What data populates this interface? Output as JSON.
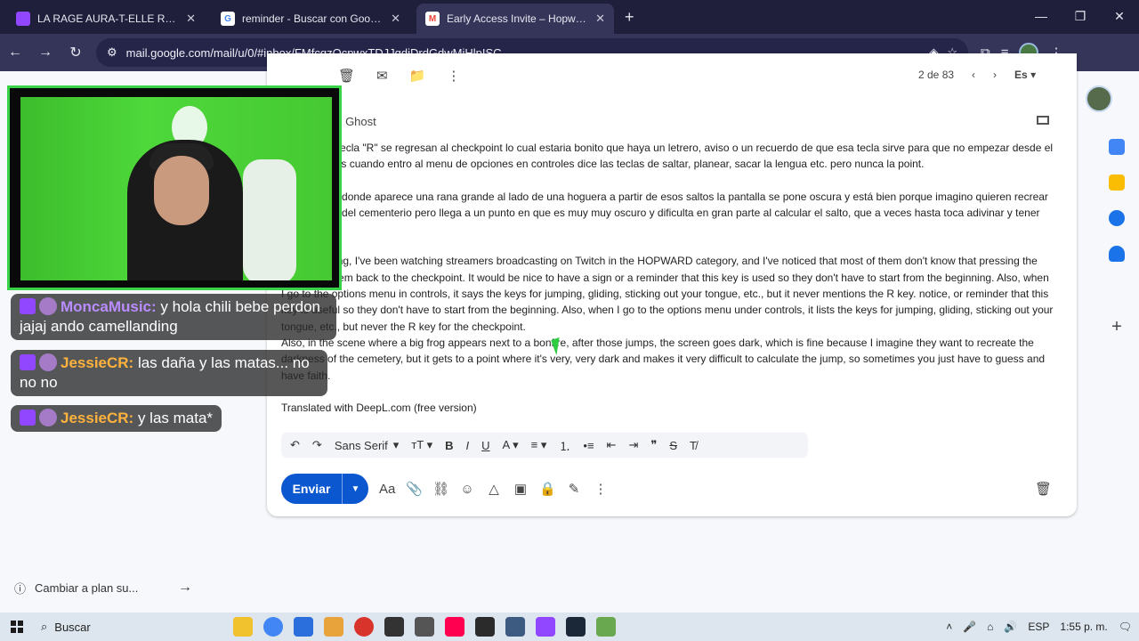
{
  "tabs": [
    {
      "title": "LA RAGE AURA-T-ELLE RAIS",
      "favicon_color": "#9146ff",
      "active": false
    },
    {
      "title": "reminder - Buscar con Google",
      "favicon_color": "#ffffff",
      "active": false
    },
    {
      "title": "Early Access Invite – Hopward L",
      "favicon_color": "#ea4335",
      "active": true
    }
  ],
  "address": {
    "url": "mail.google.com/mail/u/0/#inbox/FMfcgzQcpwxTDJJqdjDrdGdwMjHlpISC"
  },
  "gmail": {
    "pager": "2 de 83",
    "lang": "Es",
    "subject": "od Ghost",
    "body": [
      "en que con tecla \"R\" se regresan al checkpoint lo cual estaria bonito que haya un letrero, aviso o un recuerdo de que esa tecla sirve para que no empezar desde el inicio ademas cuando entro al menu de opciones en controles dice las teclas de saltar, planear, sacar la lengua etc. pero nunca la point.",
      "el escenario donde aparece una rana grande al lado de una hoguera a partir de esos saltos la pantalla se pone oscura y está bien porque imagino quieren recrear la oscuridad del cementerio pero llega a un punto en que es muy muy oscuro y dificulta en gran parte al calcular el salto, que a veces hasta toca adivinar y tener fe.",
      "Good morning, I've been watching streamers broadcasting on Twitch in the HOPWARD category, and I've noticed that most of them don't know that pressing the key takes them back to the checkpoint. It would be nice to have a sign or a reminder that this key is used so they don't have to start from the beginning. Also, when I go to the options menu in controls, it says the keys for jumping, gliding, sticking out your tongue, etc., but it never mentions the R key. notice, or reminder that this key is useful so they don't have to start from the beginning. Also, when I go to the options menu under controls, it lists the keys for jumping, gliding, sticking out your tongue, etc., but never the R key for the checkpoint.",
      "Also, in the scene where a big frog appears next to a bonfire, after those jumps, the screen goes dark, which is fine because I imagine they want to recreate the darkness of the cemetery, but it gets to a point where it's very, very dark and makes it very difficult to calculate the jump, so sometimes you just have to guess and have faith.",
      "Translated with DeepL.com (free version)"
    ],
    "font_select": "Sans Serif",
    "send_label": "Enviar",
    "sidebar_footer": "Cambiar a plan su..."
  },
  "chat": [
    {
      "user": "MoncaMusic:",
      "text": " y hola chili bebe perdon jajaj ando camellanding"
    },
    {
      "user": "JessieCR:",
      "text": " las daña y las matas... no no no"
    },
    {
      "user": "JessieCR:",
      "text": " y las mata*"
    }
  ],
  "taskbar": {
    "search": "Buscar",
    "lang": "ESP",
    "time": "1:55 p. m."
  }
}
